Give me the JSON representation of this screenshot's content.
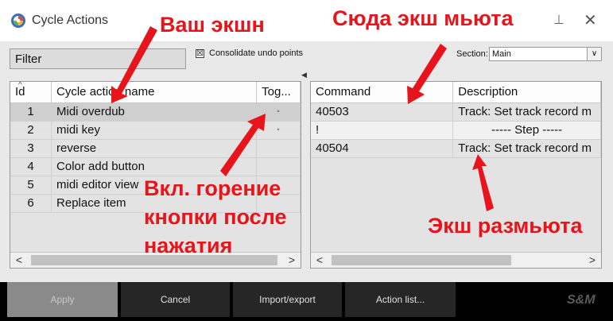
{
  "window": {
    "title": "Cycle Actions"
  },
  "filter": {
    "label": "Filter"
  },
  "consolidate": {
    "checked": "☒",
    "label": "Consolidate undo points"
  },
  "section": {
    "label": "Section:",
    "value": "Main"
  },
  "left_table": {
    "headers": [
      "Id",
      "Cycle action name",
      "Tog..."
    ],
    "rows": [
      {
        "id": "1",
        "name": "Midi overdub",
        "tog": "◦"
      },
      {
        "id": "2",
        "name": "midi key",
        "tog": "◦"
      },
      {
        "id": "3",
        "name": "reverse",
        "tog": ""
      },
      {
        "id": "4",
        "name": "Color add button",
        "tog": ""
      },
      {
        "id": "5",
        "name": "midi editor view",
        "tog": ""
      },
      {
        "id": "6",
        "name": "Replace item",
        "tog": ""
      }
    ]
  },
  "right_table": {
    "headers": [
      "Command",
      "Description"
    ],
    "rows": [
      {
        "command": "40503",
        "description": "Track: Set track record m"
      },
      {
        "command": "!",
        "description": "----- Step -----"
      },
      {
        "command": "40504",
        "description": "Track: Set track record m"
      }
    ]
  },
  "buttons": {
    "apply": "Apply",
    "cancel": "Cancel",
    "import_export": "Import/export",
    "action_list": "Action list..."
  },
  "brand": "S&M",
  "annotations": {
    "your_action": "Ваш экшн",
    "mute_here": "Сюда экш мьюта",
    "toggle_on_l1": "Вкл. горение",
    "toggle_on_l2": "кнопки после",
    "toggle_on_l3": "нажатия",
    "unmute": "Экш размьюта"
  },
  "colors": {
    "annotation": "#e8141b",
    "selected_row": "#cfcfcf"
  }
}
